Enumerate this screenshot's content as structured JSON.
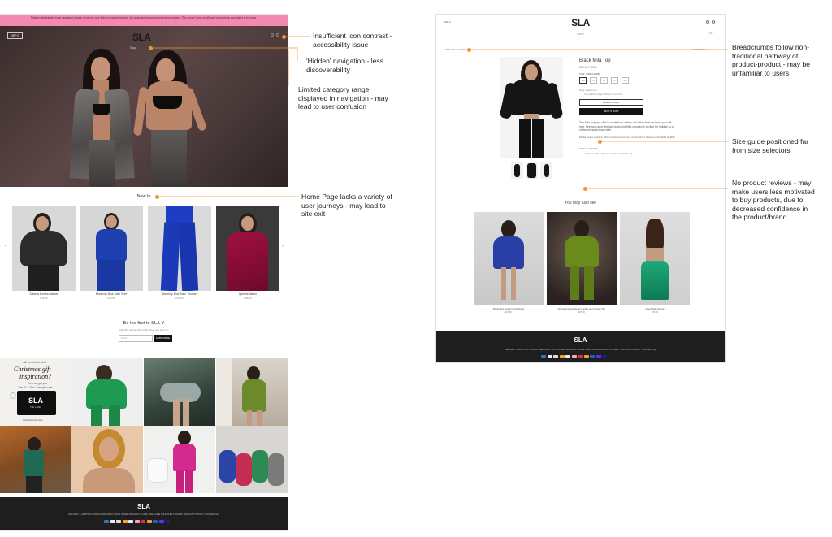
{
  "annotations": [
    {
      "id": "icon-contrast",
      "text": "Insufficient icon contrast -\naccessibility issue"
    },
    {
      "id": "hidden-nav",
      "text": "'Hidden' navigation - less\ndiscoverability"
    },
    {
      "id": "limited-category",
      "text": "Limited category range\ndisplayed in navigation - may\nlead to user confusion"
    },
    {
      "id": "home-journeys",
      "text": "Home Page lacks a variety of\nuser journeys - may lead to\nsite exit"
    },
    {
      "id": "breadcrumbs",
      "text": "Breadcrumbs follow non-\ntraditional pathway of\nproduct-product - may be\nunfamiliar to users"
    },
    {
      "id": "size-guide",
      "text": "Size guide positioned far\nfrom size selectors"
    },
    {
      "id": "no-reviews",
      "text": "No product reviews - may\nmake users less motivated\nto buy products, due to\ndecreased confidence in\nthe product/brand"
    }
  ],
  "home": {
    "promo_text": "Please note that due to an increased volume of orders, your delivery may be delayed. We apologise for any inconvenience caused. This doesn't apply to gift card or any items purchased at full price.",
    "currency": "GBP £",
    "logo": "SLA",
    "hero_nav": "Shop",
    "new_in_title": "New In",
    "products": [
      {
        "name": "Sabrina Bomber Jacket",
        "price": "£45.00"
      },
      {
        "name": "Monterey Blue Satin Shirt",
        "price": "£40.00"
      },
      {
        "name": "Monterey Blue Satin Trousers",
        "price": "£40.00"
      },
      {
        "name": "Ophelia Blazer",
        "price": "£55.00"
      }
    ],
    "prev_arrow": "‹",
    "next_arrow": "›",
    "newsletter_title": "Be the first to SLA-Y",
    "newsletter_sub": "Get 10% off your first order when you sign up!",
    "email_placeholder": "Email",
    "subscribe_label": "SUBSCRIBE",
    "gift": {
      "line1": "still no idea of what",
      "line2": "Christmas gift",
      "line3": "inspiration?",
      "line4": "then we got you",
      "line5": "The SLA The Label gift card",
      "card_logo": "SLA",
      "card_sub": "THE LABEL",
      "shop_now": "Shop Gift Cards Now"
    },
    "footer_logo": "SLA",
    "footer_links": "DELIVERY & SHIPPING   CONTACT   REFUNDS   TRACK ORDER   WASHING & CARE   SIZE GUIDE   AFFILIATES   STUDENT DISCOUNT   PRIVACY   COOKIES   FAQ"
  },
  "pdp": {
    "currency": "GBP £",
    "logo": "SLA",
    "shop_menu": "SHOP",
    "cart_count": "0",
    "prev_product": "◂ PREVIOUS PRODUCT",
    "next_product": "NEXT ITEM ▸",
    "title": "Black Mila Top",
    "price": "£24.00 PRICE",
    "size_label": "SIZE",
    "size_guide_link": "SIZE GUIDE",
    "sizes": [
      "XS",
      "S",
      "M",
      "L",
      "XL"
    ],
    "stock_note": "Only 4 items left",
    "stock_sub": "Spend £50 and get 25% off your order",
    "add_to_cart": "ADD TO CART",
    "buy_now": "BUY IT NOW",
    "description": "The Mila cropped shirt is made from a linen mix fabric that we know you will love. Dressed up or dressed down the Mila cropped is perfect for holiday or a chilled dressed down vibe.",
    "model_note": "Model wears a size S. Tall girl size and not sure of your size? check out the SIZE GUIDE",
    "model_height": "Model height 5'8",
    "care": "Wash on 30 degrees and do not tumble dry",
    "ymal_title": "You may also like",
    "recs": [
      {
        "name": "Royal Blue Sequin Short Dress",
        "price": "£65.00"
      },
      {
        "name": "Emerald Green Sequin Jacket and Trouser Set",
        "price": "£65.00"
      },
      {
        "name": "Green Satin Dress",
        "price": "£55.00"
      }
    ],
    "footer_logo": "SLA",
    "footer_links": "DELIVERY & SHIPPING   CONTACT   REFUNDS   TRACK ORDER   WASHING & CARE   SIZE GUIDE   AFFILIATES   STUDENT DISCOUNT   PRIVACY   COOKIES   FAQ"
  },
  "colors": {
    "accent": "#f0952b",
    "promo_pink": "#f28ab0",
    "footer_dark": "#1e1e1e"
  }
}
